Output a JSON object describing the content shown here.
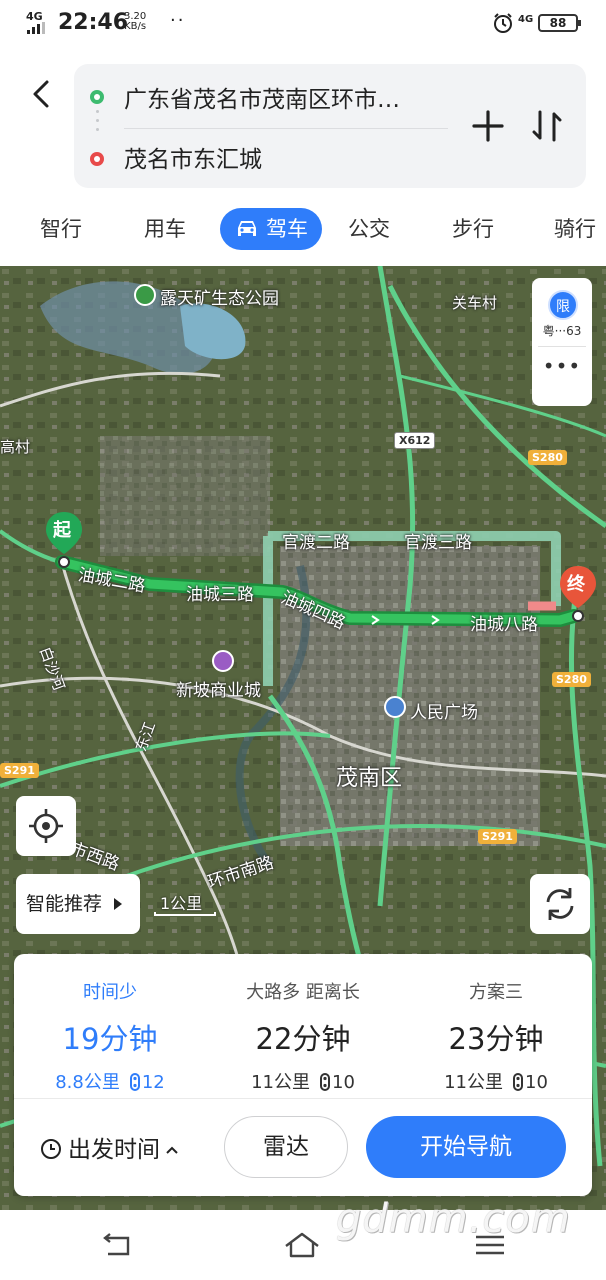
{
  "status_bar": {
    "network": "4G",
    "time": "22:46",
    "speed_value": "3.20",
    "speed_unit": "KB/s",
    "dots": "··",
    "net_right": "4G",
    "battery": "88"
  },
  "route": {
    "from": "广东省茂名市茂南区环市…",
    "to": "茂名市东汇城"
  },
  "tabs": [
    {
      "label": "智行"
    },
    {
      "label": "用车"
    },
    {
      "label": "驾车",
      "active": true
    },
    {
      "label": "公交"
    },
    {
      "label": "步行"
    },
    {
      "label": "骑行"
    }
  ],
  "map": {
    "labels": {
      "park": "露天矿生态公园",
      "village_ne": "关车村",
      "village_w": "高村",
      "x612": "X612",
      "s280_top": "S280",
      "s280_mid": "S280",
      "s291_left": "S291",
      "s291_right": "S291",
      "guandu2": "官渡二路",
      "guandu3": "官渡三路",
      "youcheng2": "油城二路",
      "youcheng3": "油城三路",
      "youcheng4": "油城四路",
      "youcheng8": "油城八路",
      "xinpo": "新坡商业城",
      "renmin": "人民广场",
      "maonan": "茂南区",
      "baisha": "白沙河",
      "dongjiang": "东江",
      "huanshi_w": "市西路",
      "huanshi_s": "环市南路"
    },
    "start_label": "起",
    "end_label": "终",
    "limit": {
      "icon": "限",
      "plate": "粤···63",
      "more": "•••"
    },
    "smart_recommend": "智能推荐",
    "scale": "1公里"
  },
  "plans": [
    {
      "tag": "时间少",
      "time": "19分钟",
      "distance": "8.8公里",
      "lights": "12",
      "active": true
    },
    {
      "tag": "大路多  距离长",
      "time": "22分钟",
      "distance": "11公里",
      "lights": "10"
    },
    {
      "tag": "方案三",
      "time": "23分钟",
      "distance": "11公里",
      "lights": "10"
    }
  ],
  "actions": {
    "depart_time": "出发时间",
    "radar": "雷达",
    "start_nav": "开始导航"
  },
  "watermark": "gdmm.com",
  "colors": {
    "accent": "#2f7dfa",
    "route": "#2fbf5e",
    "start": "#3dbb6f",
    "end": "#e84a4a"
  }
}
